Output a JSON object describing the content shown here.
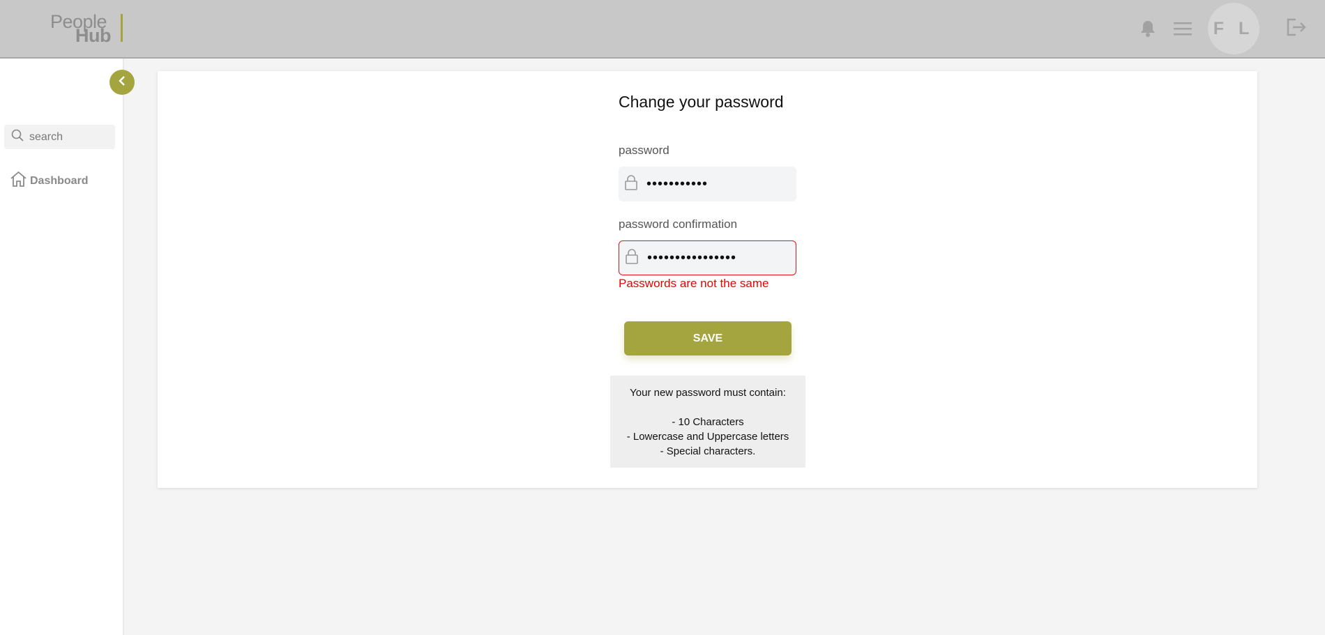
{
  "header": {
    "logo_top": "People",
    "logo_bottom": "Hub",
    "avatar_initials": "F L",
    "icons": [
      "bell-icon",
      "menu-icon",
      "logout-icon"
    ]
  },
  "sidebar": {
    "search_placeholder": "search",
    "items": [
      {
        "label": "Dashboard",
        "icon": "home-icon"
      }
    ]
  },
  "form": {
    "title": "Change your password",
    "password_label": "password",
    "password_value": "•••••••••••",
    "confirmation_label": "password confirmation",
    "confirmation_value": "••••••••••••••••",
    "error_message": "Passwords are not the same",
    "save_label": "SAVE"
  },
  "requirements": {
    "heading": "Your new password must contain:",
    "items": [
      "- 10 Characters",
      "- Lowercase and Uppercase letters",
      "- Special characters."
    ]
  },
  "colors": {
    "accent": "#a4a53e",
    "error": "#ee1111",
    "topbar": "#c8c8c8"
  }
}
